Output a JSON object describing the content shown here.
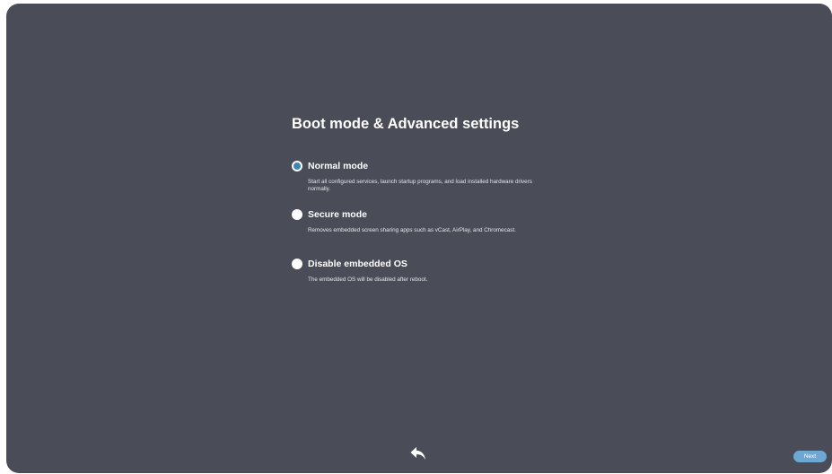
{
  "title": "Boot mode & Advanced settings",
  "options": [
    {
      "label": "Normal mode",
      "description": "Start all configured services, launch startup programs, and load installed hardware drivers normally.",
      "selected": true
    },
    {
      "label": "Secure mode",
      "description": "Removes embedded screen sharing apps such as vCast, AirPlay, and Chromecast.",
      "selected": false
    },
    {
      "label": "Disable embedded OS",
      "description": "The embedded OS will be disabled after reboot.",
      "selected": false
    }
  ],
  "footer": {
    "back_icon": "back-arrow-icon",
    "next_label": "Next"
  },
  "colors": {
    "background": "#4a4c57",
    "accent": "#3a87b8",
    "next_button": "#6ea8d2"
  }
}
